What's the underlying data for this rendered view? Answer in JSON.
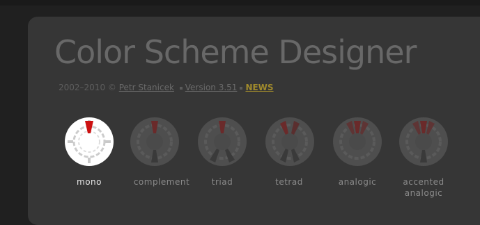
{
  "app": {
    "title": "Color Scheme Designer",
    "years": "2002–2010 ©",
    "author_link": "Petr Stanicek",
    "version_link": "Version 3.51",
    "news_link": "NEWS"
  },
  "schemes": [
    {
      "label": "mono",
      "active": true
    },
    {
      "label": "complement",
      "active": false
    },
    {
      "label": "triad",
      "active": false
    },
    {
      "label": "tetrad",
      "active": false
    },
    {
      "label": "analogic",
      "active": false
    },
    {
      "label": "accented",
      "label2": "analogic",
      "active": false
    }
  ],
  "colors": {
    "accent_red": "#cc1111",
    "active_wheel": "#ffffff",
    "inactive_wheel": "#4e4e4e",
    "news_gold": "#a08a2c"
  }
}
